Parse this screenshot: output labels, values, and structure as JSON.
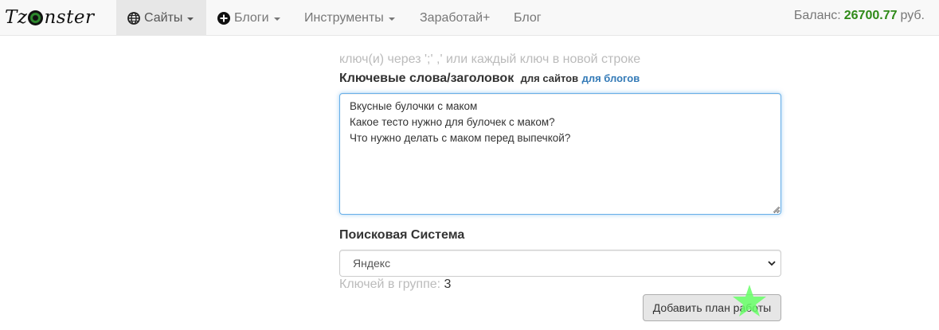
{
  "navbar": {
    "brand": {
      "before": "Tz",
      "after": "nster",
      "icon": "eye-o-icon"
    },
    "items": [
      {
        "label": "Сайты",
        "icon": "globe-icon",
        "dropdown": true,
        "active": true
      },
      {
        "label": "Блоги",
        "icon": "plus-circle-icon",
        "dropdown": true,
        "active": false
      },
      {
        "label": "Инструменты",
        "dropdown": true,
        "active": false
      },
      {
        "label": "Заработай+",
        "dropdown": false,
        "active": false
      },
      {
        "label": "Блог",
        "dropdown": false,
        "active": false
      }
    ],
    "balance": {
      "label": "Баланс:",
      "amount": "26700.77",
      "currency": "руб.",
      "amount_color": "#2f8a18"
    }
  },
  "form": {
    "hint": "ключ(и) через ';' ,' или каждый ключ в новой строке",
    "keywords_label": "Ключевые слова/заголовок",
    "for_sites": "для сайтов",
    "for_blogs": "для блогов",
    "keywords_value": "Вкусные булочки с маком\nКакое тесто нужно для булочек с маком?\nЧто нужно делать с маком перед выпечкой?",
    "search_engine_label": "Поисковая Система",
    "search_engine_selected": "Яндекс",
    "group_count_label": "Ключей в группе:",
    "group_count_value": "3",
    "add_button": "Добавить план работы"
  },
  "colors": {
    "link": "#337ab7",
    "focus_border": "#66afe9",
    "cursor_star": "#66ff66"
  }
}
